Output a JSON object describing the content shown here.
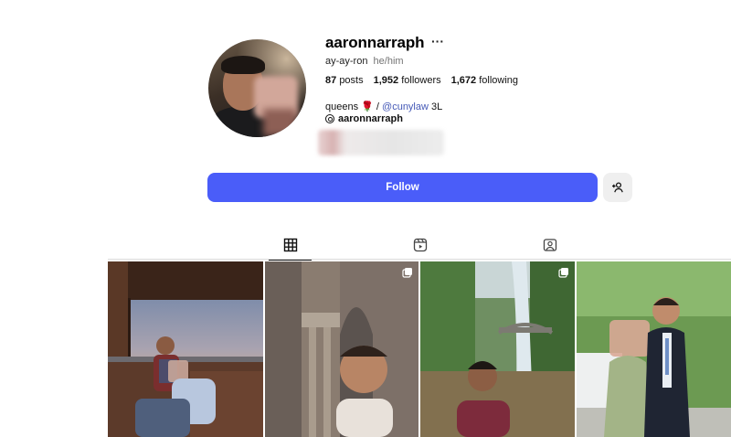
{
  "profile": {
    "username": "aaronnarraph",
    "more_label": "···",
    "name": "ay-ay-ron",
    "pronouns": "he/him",
    "stats": {
      "posts_count": "87",
      "posts_label": "posts",
      "followers_count": "1,952",
      "followers_label": "followers",
      "following_count": "1,672",
      "following_label": "following"
    },
    "bio": {
      "prefix": "queens",
      "emoji": "🌹",
      "separator": " / ",
      "link": "@cunylaw",
      "suffix": " 3L"
    },
    "threads_handle": "aaronnarraph"
  },
  "actions": {
    "follow_label": "Follow"
  },
  "tabs": [
    {
      "name": "posts",
      "icon": "grid-icon",
      "active": true
    },
    {
      "name": "reels",
      "icon": "reels-icon",
      "active": false
    },
    {
      "name": "tagged",
      "icon": "tagged-icon",
      "active": false
    }
  ],
  "colors": {
    "follow_button": "#4a5df9",
    "link": "#4559b7",
    "secondary_text": "#737373"
  }
}
